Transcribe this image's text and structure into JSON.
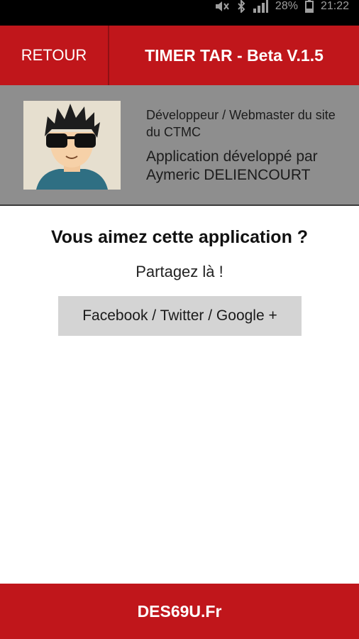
{
  "status_bar": {
    "battery_percent": "28%",
    "time": "21:22",
    "icons": [
      "muted-icon",
      "bluetooth-icon",
      "signal-icon",
      "battery-icon"
    ]
  },
  "app_bar": {
    "back_label": "RETOUR",
    "title": "TIMER TAR - Beta V.1.5",
    "color": "#c0161b"
  },
  "developer": {
    "role": "Développeur / Webmaster du site du CTMC",
    "credit": "Application développé par Aymeric DELIENCOURT",
    "avatar": "cartoon-avatar-sunglasses"
  },
  "share": {
    "title": "Vous aimez cette application ?",
    "subtitle": "Partagez là !",
    "button_label": "Facebook / Twitter / Google +"
  },
  "footer": {
    "text": "DES69U.Fr"
  }
}
